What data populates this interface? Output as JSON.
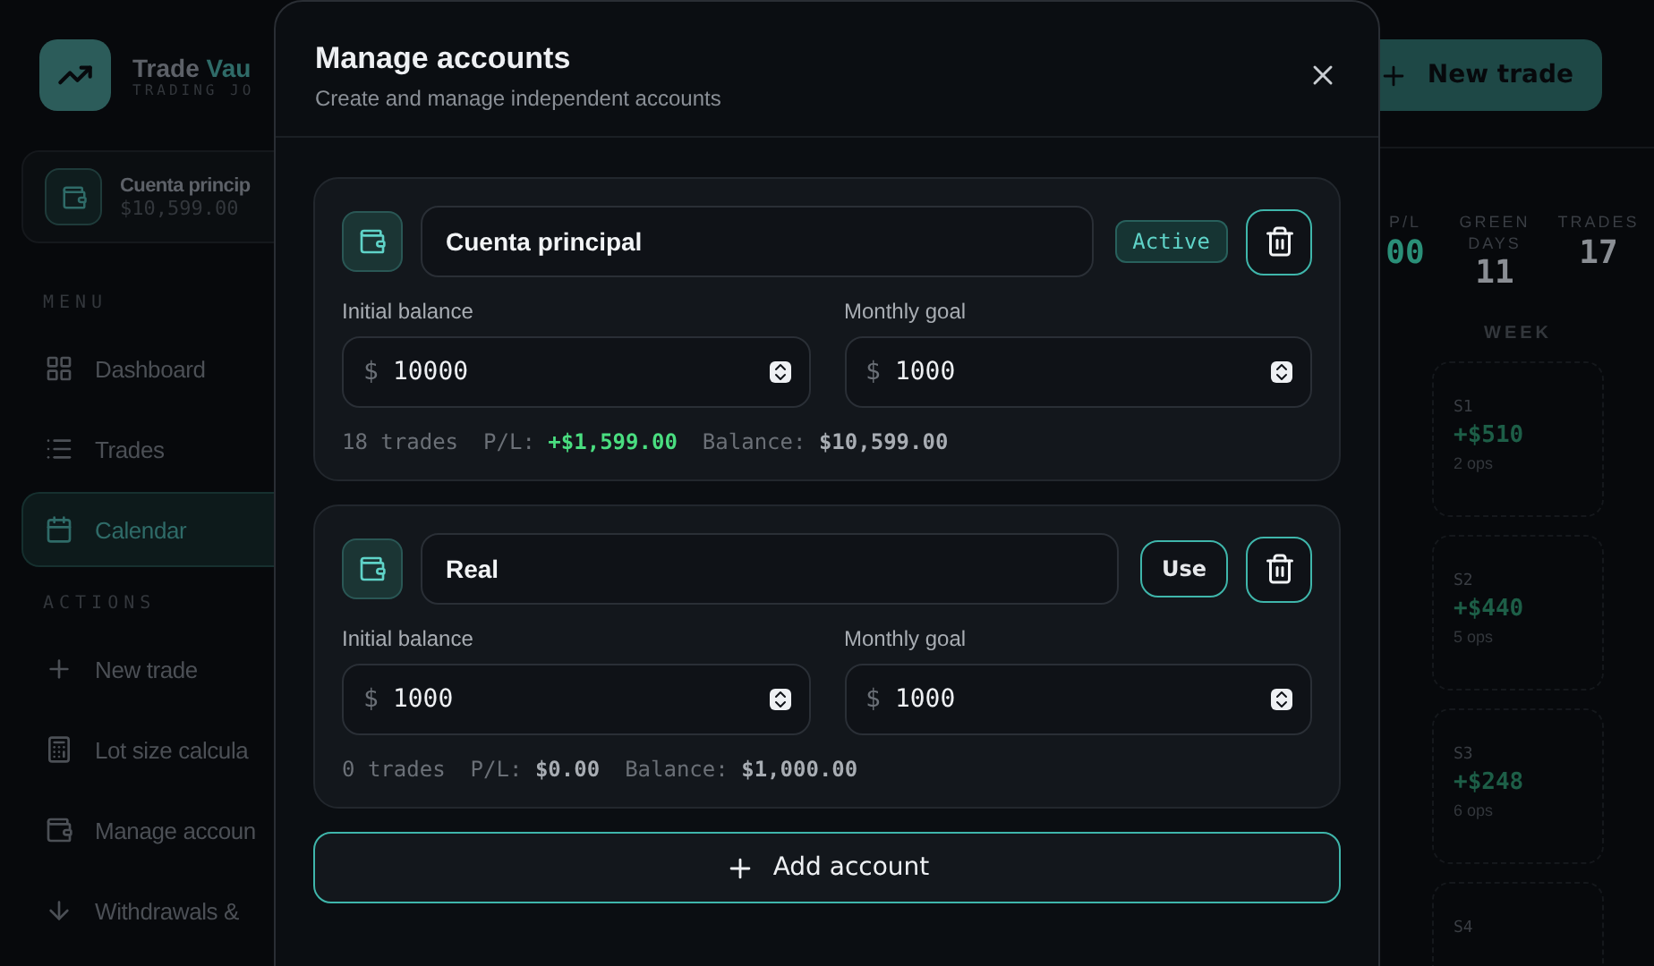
{
  "app": {
    "brand": {
      "name_plain": "Trade",
      "name_accent": "Vau",
      "tagline": "TRADING JO"
    },
    "current_account": {
      "name": "Cuenta princip",
      "balance": "$10,599.00"
    },
    "sidebar": {
      "sections": [
        {
          "title": "MENU",
          "items": [
            {
              "label": "Dashboard",
              "selected": false
            },
            {
              "label": "Trades",
              "selected": false
            },
            {
              "label": "Calendar",
              "selected": true
            }
          ]
        },
        {
          "title": "ACTIONS",
          "items": [
            {
              "label": "New trade",
              "selected": false
            },
            {
              "label": "Lot size calcula",
              "selected": false
            },
            {
              "label": "Manage accoun",
              "selected": false
            },
            {
              "label": "Withdrawals &",
              "selected": false
            }
          ]
        }
      ]
    },
    "new_trade_button": "New trade",
    "stats": [
      {
        "label": "P/L",
        "value": "00",
        "color": "#2a8f78"
      },
      {
        "label": "GREEN DAYS",
        "value": "11",
        "color": "#8a8e94"
      },
      {
        "label": "TRADES",
        "value": "17",
        "color": "#8a8e94"
      }
    ],
    "week_column": {
      "title": "WEEK",
      "weeks": [
        {
          "label": "S1",
          "amount": "+$510",
          "ops": "2 ops"
        },
        {
          "label": "S2",
          "amount": "+$440",
          "ops": "5 ops"
        },
        {
          "label": "S3",
          "amount": "+$248",
          "ops": "6 ops"
        },
        {
          "label": "S4"
        }
      ]
    }
  },
  "dialog": {
    "title": "Manage accounts",
    "subtitle": "Create and manage independent accounts",
    "accounts": [
      {
        "name": "Cuenta principal",
        "selected": true,
        "action": "Active",
        "fields": [
          {
            "label": "Initial balance",
            "currency": "$",
            "value": "10000"
          },
          {
            "label": "Monthly goal",
            "currency": "$",
            "value": "1000"
          }
        ],
        "trades": "18 trades",
        "pl_label": "P/L:",
        "pl_value": "+$1,599.00",
        "color": "#4ade80",
        "balance_label": "Balance:",
        "balance_value": "$10,599.00"
      },
      {
        "name": "Real",
        "selected": false,
        "action": "Use",
        "fields": [
          {
            "label": "Initial balance",
            "currency": "$",
            "value": "1000"
          },
          {
            "label": "Monthly goal",
            "currency": "$",
            "value": "1000"
          }
        ],
        "trades": "0 trades",
        "pl_label": "P/L:",
        "pl_value": "$0.00",
        "color": "#a8adb3",
        "balance_label": "Balance:",
        "balance_value": "$1,000.00"
      }
    ],
    "add_button": "Add account"
  }
}
